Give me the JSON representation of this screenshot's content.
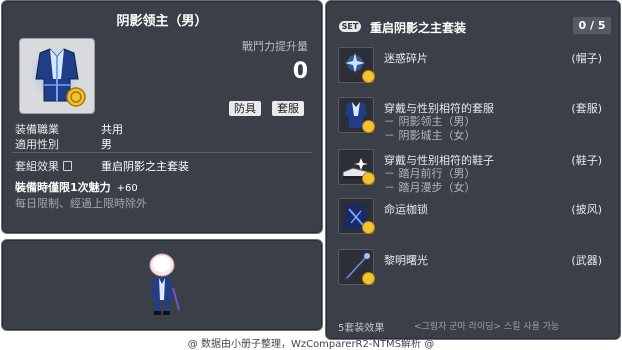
{
  "item_id": "01050521",
  "item": {
    "name": "阴影领主（男）",
    "power_label": "戰鬥力提升量",
    "power_value": "0",
    "tags": [
      "防具",
      "套服"
    ],
    "job_label": "装備職業",
    "job_value": "共用",
    "gender_label": "適用性別",
    "gender_value": "男",
    "set_label": "套組效果",
    "set_value": "重启阴影之主套装",
    "limit_text": "裝備時僅限1次魅力",
    "limit_bonus": "+60",
    "note": "每日限制、經過上限時除外"
  },
  "set": {
    "badge": "SET",
    "title": "重启阴影之主套装",
    "count": "0 / 5",
    "pieces": [
      {
        "name": "迷惑碎片",
        "slot": "(帽子)",
        "subs": []
      },
      {
        "name": "穿戴与性别相符的套服",
        "slot": "(套服)",
        "subs": [
          "－ 阴影领主（男）",
          "－ 阴影城主（女）"
        ]
      },
      {
        "name": "穿戴与性别相符的鞋子",
        "slot": "(鞋子)",
        "subs": [
          "－ 踏月前行（男）",
          "－ 踏月漫步（女）"
        ]
      },
      {
        "name": "命运枷锁",
        "slot": "(披风)",
        "subs": []
      },
      {
        "name": "黎明曙光",
        "slot": "(武器)",
        "subs": []
      }
    ],
    "effect_label": "5套装效果",
    "effect_value": "<그림자 군마 라이딩> 스킬 사용 가능"
  },
  "footer": "@ 数据由小册子整理，WzComparerR2-NTMS解析 @",
  "colors": {
    "panel_bg": "#3b3f48",
    "coin": "#f2c230",
    "accent_blue": "#3a6fd0"
  }
}
